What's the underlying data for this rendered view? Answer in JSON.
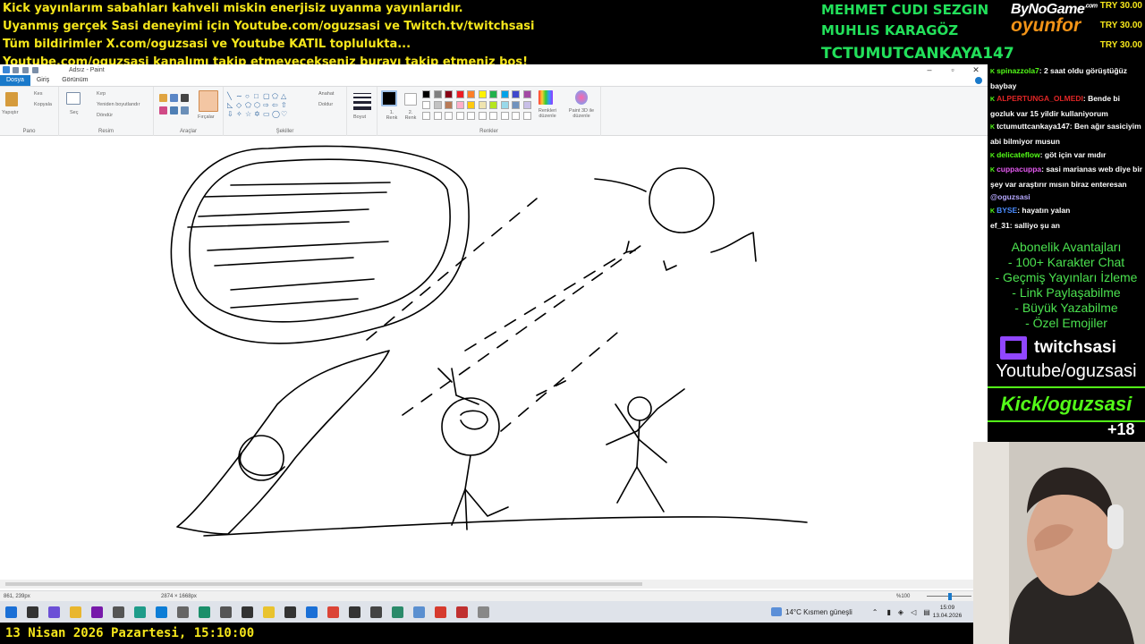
{
  "banner": {
    "lines": [
      "Kick yayınlarım sabahları kahveli miskin enerjisiz uyanma yayınlarıdır.",
      "Uyanmış gerçek Sasi deneyimi için Youtube.com/oguzsasi ve Twitch.tv/twitchsasi",
      "Tüm bildirimler X.com/oguzsasi ve Youtube KATIL toplulukta...",
      "Youtube.com/oguzsasi kanalımı takip etmeyecekseniz burayı takip etmeniz boş!"
    ]
  },
  "sponsors": {
    "names": [
      "MEHMET CUDI SEZGIN",
      "MUHLIS KARAGÖZ",
      "TCTUMUTCANKAYA147"
    ],
    "prices": [
      "TRY 30.00",
      "TRY 30.00",
      "TRY 30.00"
    ],
    "brand_top": "ByNoGame",
    "brand_com": ".com",
    "brand_bottom": "oyunfor"
  },
  "paint": {
    "title": "Adsız - Paint",
    "menu": {
      "file": "Dosya",
      "home": "Giriş",
      "view": "Görünüm"
    },
    "ribbon": {
      "paste": "Yapıştır",
      "cut": "Kes",
      "copy": "Kopyala",
      "select": "Seç",
      "crop": "Kırp",
      "resize": "Yeniden boyutlandır",
      "rotate": "Döndür",
      "brushes": "Fırçalar",
      "outline": "Anahat",
      "fill": "Doldur",
      "size": "Boyut",
      "color1": "1. Renk",
      "color2": "2. Renk",
      "edit_colors": "Renkleri düzenle",
      "paint3d": "Paint 3D ile düzenle",
      "groups": {
        "clipboard": "Pano",
        "image": "Resim",
        "tools": "Araçlar",
        "shapes": "Şekiller",
        "colors": "Renkler"
      }
    },
    "palette_row1": [
      "#000000",
      "#7f7f7f",
      "#880015",
      "#ed1c24",
      "#ff7f27",
      "#fff200",
      "#22b14c",
      "#00a2e8",
      "#3f48cc",
      "#a349a4"
    ],
    "palette_row2": [
      "#ffffff",
      "#c3c3c3",
      "#b97a57",
      "#ffaec9",
      "#ffc90e",
      "#efe4b0",
      "#b5e61d",
      "#99d9ea",
      "#7092be",
      "#c8bfe7"
    ],
    "status": {
      "cursor": "861, 239px",
      "canvas_size": "2874 × 1668px",
      "zoom": "%100"
    }
  },
  "chat": {
    "messages": [
      {
        "user": "spinazzola7",
        "text": ": 2 saat oldu görüştüğüz baybay",
        "color": "#53fc18"
      },
      {
        "user": "ALPERTUNGA_OLMEDI",
        "text": ": Bende bi gozluk var 15 yildir kullaniyorum",
        "color": "#e02626"
      },
      {
        "user": "tctumuttcankaya147",
        "text": ": Ben ağır sasiciyim abi bilmiyor musun",
        "color": "#ffffff"
      },
      {
        "user": "delicateflow",
        "text": ": göt için var mıdır",
        "color": "#53fc18"
      },
      {
        "user": "cuppacuppa",
        "text": ": sasi marianas web diye bir şey var araştırır mısın biraz enteresan",
        "color": "#e45af0",
        "mention": "@oguzsasi"
      },
      {
        "user": "BYSE",
        "text": ": hayatın yalan",
        "color": "#4a8cff"
      },
      {
        "user": "ef_31",
        "text": ": salliyo şu an",
        "color": "#ffffff"
      }
    ]
  },
  "perks": {
    "lines": [
      "Abonelik Avantajları",
      "- 100+ Karakter Chat",
      "- Geçmiş Yayınları İzleme",
      "- Link Paylaşabilme",
      "- Büyük Yazabilme",
      "- Özel Emojiler"
    ]
  },
  "socials": {
    "twitch": "twitchsasi",
    "youtube": "Youtube/oguzsasi",
    "kick": "Kick/oguzsasi",
    "viewers": "+18"
  },
  "taskbar": {
    "weather": "14°C  Kısmen güneşli",
    "time": "15:09",
    "date": "13.04.2026"
  },
  "footer": {
    "datetime": "13 Nisan 2026 Pazartesi, 15:10:00"
  }
}
